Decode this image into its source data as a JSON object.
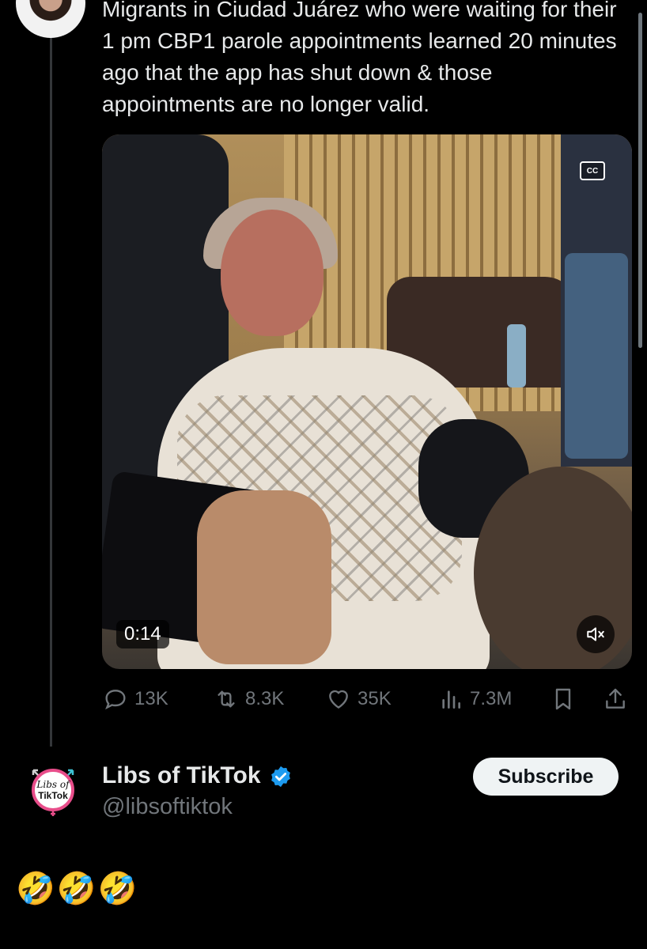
{
  "quoted_tweet": {
    "text": "Migrants in Ciudad Juárez who were waiting for their 1 pm CBP1 parole appointments learned 20 minutes ago that the app has shut down & those appointments are no longer valid."
  },
  "video": {
    "cc_label": "CC",
    "timestamp": "0:14",
    "mute_icon": "speaker-muted-icon"
  },
  "actions": {
    "replies": "13K",
    "reposts": "8.3K",
    "likes": "35K",
    "views": "7.3M"
  },
  "author": {
    "name": "Libs of TikTok",
    "handle": "@libsoftiktok",
    "logo_line1": "Libs of",
    "logo_line2": "TikTok",
    "verified_color": "#1d9bf0"
  },
  "subscribe_label": "Subscribe",
  "reply_text": "🤣🤣🤣"
}
